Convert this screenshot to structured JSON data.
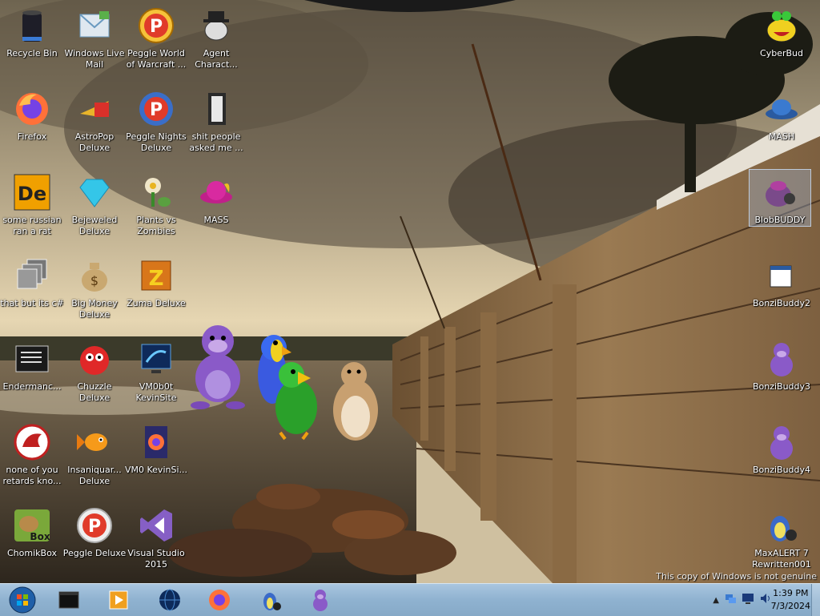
{
  "desktop": {
    "icons": [
      {
        "label": "Recycle Bin",
        "icon": "recycle-bin-icon"
      },
      {
        "label": "Windows Live Mail",
        "icon": "mail-icon"
      },
      {
        "label": "Peggle World of Warcraft ...",
        "icon": "peggle-icon"
      },
      {
        "label": "Agent Charact...",
        "icon": "agent-character-icon"
      },
      {
        "label": "Firefox",
        "icon": "firefox-icon"
      },
      {
        "label": "AstroPop Deluxe",
        "icon": "astropop-icon"
      },
      {
        "label": "Peggle Nights Deluxe",
        "icon": "peggle-nights-icon"
      },
      {
        "label": "shit people asked me ...",
        "icon": "folder-icon"
      },
      {
        "label": "some russian ran a rat",
        "icon": "de-icon"
      },
      {
        "label": "Bejeweled Deluxe",
        "icon": "gem-icon"
      },
      {
        "label": "Plants vs Zombies",
        "icon": "flower-icon"
      },
      {
        "label": "MASS",
        "icon": "hat-icon"
      },
      {
        "label": "that but its c#",
        "icon": "windows-stack-icon"
      },
      {
        "label": "Big Money Deluxe",
        "icon": "money-bag-icon"
      },
      {
        "label": "Zuma Deluxe",
        "icon": "zuma-icon"
      },
      {
        "label": "Endermanc...",
        "icon": "console-icon"
      },
      {
        "label": "Chuzzle Deluxe",
        "icon": "chuzzle-icon"
      },
      {
        "label": "VM0b0t KevinSite",
        "icon": "vm-icon"
      },
      {
        "label": "none of you retards kno...",
        "icon": "red-dragon-icon"
      },
      {
        "label": "Insaniquar... Deluxe",
        "icon": "fish-icon"
      },
      {
        "label": "VM0 KevinSi...",
        "icon": "firefox-doc-icon"
      },
      {
        "label": "ChomikBox",
        "icon": "chomikbox-icon"
      },
      {
        "label": "Peggle Deluxe",
        "icon": "peggle-icon"
      },
      {
        "label": "Visual Studio 2015",
        "icon": "visual-studio-icon"
      },
      {
        "label": "CyberBud",
        "icon": "cyberbud-icon"
      },
      {
        "label": "MASH",
        "icon": "mash-hat-icon"
      },
      {
        "label": "BlobBUDDY",
        "icon": "blob-icon"
      },
      {
        "label": "BonziBuddy2",
        "icon": "window-icon"
      },
      {
        "label": "BonziBuddy3",
        "icon": "bonzi-icon"
      },
      {
        "label": "BonziBuddy4",
        "icon": "bonzi-icon"
      },
      {
        "label": "MaxALERT 7 Rewritten001",
        "icon": "maxalert-icon"
      }
    ],
    "watermark": "This copy of Windows is not genuine",
    "agents": [
      "bonzi-gorilla",
      "blue-parrot",
      "green-parrot",
      "hamster"
    ]
  },
  "taskbar": {
    "buttons": [
      "start-orb-icon",
      "terminal-icon",
      "media-player-icon",
      "globe-icon",
      "firefox-icon",
      "agent-parrot-icon",
      "bonzi-icon"
    ],
    "tray_icons": [
      "show-hidden-arrow-icon",
      "network-icon",
      "monitor-icon",
      "volume-icon"
    ],
    "time": "1:39 PM",
    "date": "7/3/2024"
  }
}
